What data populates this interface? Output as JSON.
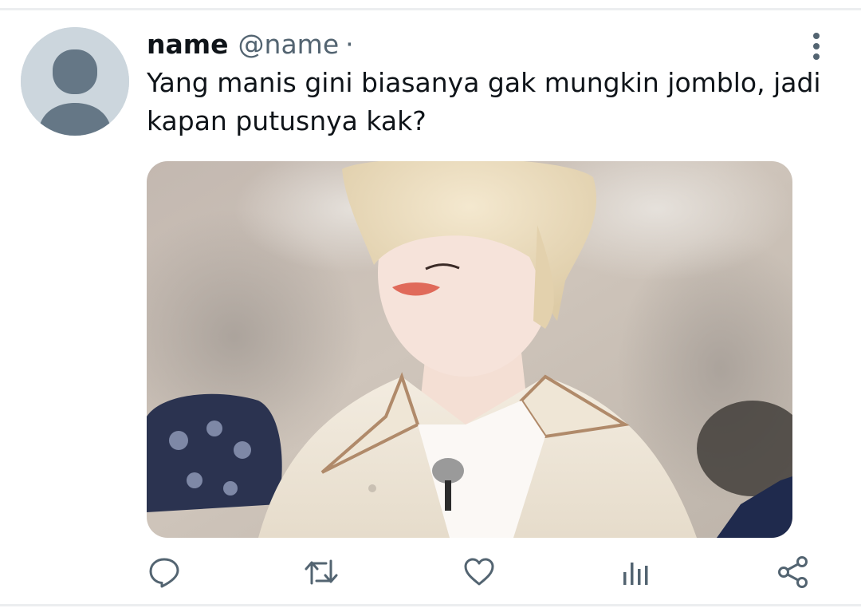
{
  "tweet": {
    "display_name": "name",
    "handle": "@name",
    "separator": "·",
    "text": "Yang manis gini biasanya gak mungkin jomblo, jadi kapan putusnya kak?"
  },
  "colors": {
    "secondary_text": "#536471",
    "icon": "#536471",
    "avatar_bg": "#ccd6dd",
    "avatar_fg": "#657786"
  },
  "icons": {
    "more": "more-vertical-icon",
    "reply": "reply-icon",
    "retweet": "retweet-icon",
    "like": "heart-icon",
    "analytics": "analytics-icon",
    "share": "share-icon"
  }
}
